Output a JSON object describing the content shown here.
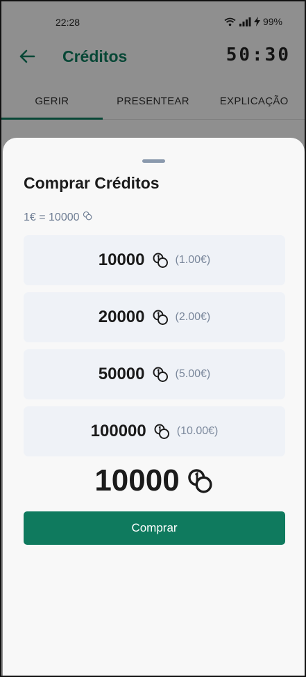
{
  "status_bar": {
    "time": "22:28",
    "battery": "99%",
    "icons": [
      "wifi-icon",
      "signal-icon",
      "charging-icon"
    ]
  },
  "app_bar": {
    "back_icon": "arrow-left-icon",
    "title": "Créditos",
    "timer": "50:30"
  },
  "tabs": [
    {
      "label": "GERIR",
      "active": true
    },
    {
      "label": "PRESENTEAR",
      "active": false
    },
    {
      "label": "EXPLICAÇÃO",
      "active": false
    }
  ],
  "sheet": {
    "title": "Comprar Créditos",
    "rate": "1€ = 10000",
    "coin_icon": "coins-icon",
    "options": [
      {
        "amount": "10000",
        "price": "(1.00€)"
      },
      {
        "amount": "20000",
        "price": "(2.00€)"
      },
      {
        "amount": "50000",
        "price": "(5.00€)"
      },
      {
        "amount": "100000",
        "price": "(10.00€)"
      }
    ],
    "selected_amount": "10000",
    "buy_label": "Comprar"
  },
  "colors": {
    "accent": "#0f7a5e",
    "option_bg": "#eff2f7",
    "muted_text": "#7b889c",
    "handle": "#8a99ad"
  }
}
